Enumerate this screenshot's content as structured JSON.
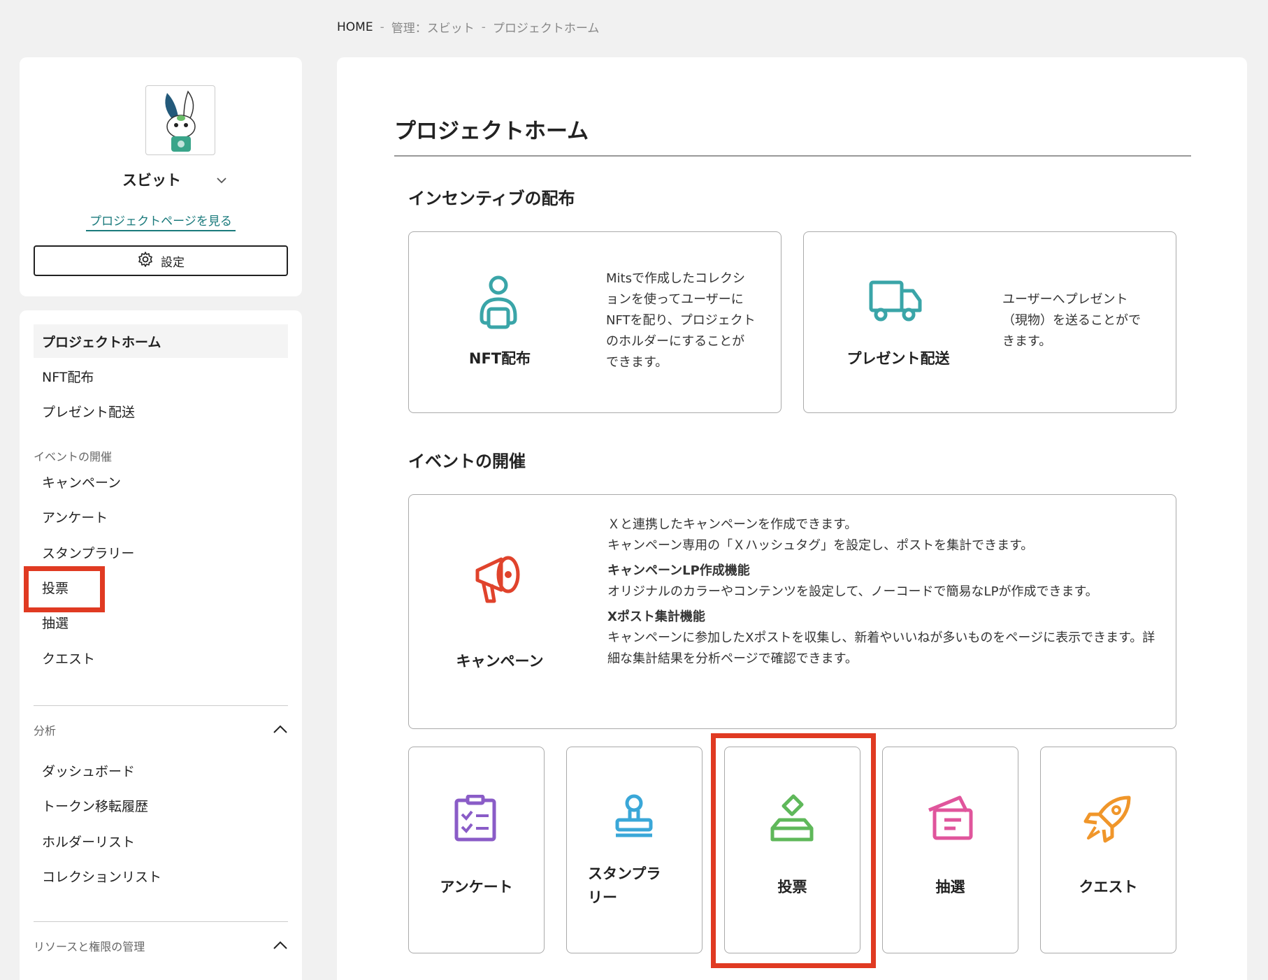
{
  "breadcrumb": {
    "home": "HOME",
    "sep": "-",
    "admin": "管理：スビット",
    "current": "プロジェクトホーム"
  },
  "profile": {
    "name": "スビット",
    "link": "プロジェクトページを見る",
    "settings": "設定"
  },
  "nav": {
    "home": "プロジェクトホーム",
    "nft": "NFT配布",
    "present": "プレゼント配送",
    "events_label": "イベントの開催",
    "campaign": "キャンペーン",
    "survey": "アンケート",
    "stamp": "スタンプラリー",
    "vote": "投票",
    "lottery": "抽選",
    "quest": "クエスト",
    "analysis_label": "分析",
    "dashboard": "ダッシュボード",
    "token_history": "トークン移転履歴",
    "holder_list": "ホルダーリスト",
    "collection_list": "コレクションリスト",
    "resources_label": "リソースと権限の管理"
  },
  "main": {
    "title": "プロジェクトホーム",
    "incentive_title": "インセンティブの配布",
    "nft_card": {
      "title": "NFT配布",
      "desc": "Mitsで作成したコレクションを使ってユーザーにNFTを配り、プロジェクトのホルダーにすることができます。"
    },
    "present_card": {
      "title": "プレゼント配送",
      "desc": "ユーザーへプレゼント（現物）を送ることができます。"
    },
    "event_title": "イベントの開催",
    "campaign_card": {
      "title": "キャンペーン",
      "line1": "Ｘと連携したキャンペーンを作成できます。",
      "line2": "キャンペーン専用の「Ｘハッシュタグ」を設定し、ポストを集計できます。",
      "sub1": "キャンペーンLP作成機能",
      "desc1": "オリジナルのカラーやコンテンツを設定して、ノーコードで簡易なLPが作成できます。",
      "sub2": "Xポスト集計機能",
      "desc2": "キャンペーンに参加したXポストを収集し、新着やいいねが多いものをページに表示できます。詳細な集計結果を分析ページで確認できます。"
    },
    "small_cards": [
      {
        "title": "アンケート",
        "icon": "clipboard-check-icon",
        "color": "#8a5cc7"
      },
      {
        "title": "スタンプラリー",
        "icon": "stamp-icon",
        "color": "#3aa7d8"
      },
      {
        "title": "投票",
        "icon": "ballot-box-icon",
        "color": "#5fb85a"
      },
      {
        "title": "抽選",
        "icon": "lottery-ticket-icon",
        "color": "#e0559c"
      },
      {
        "title": "クエスト",
        "icon": "rocket-icon",
        "color": "#f0962a"
      }
    ]
  },
  "colors": {
    "accent_teal": "#3aa5a8",
    "campaign_red": "#e0432c",
    "highlight": "#e03a22"
  }
}
